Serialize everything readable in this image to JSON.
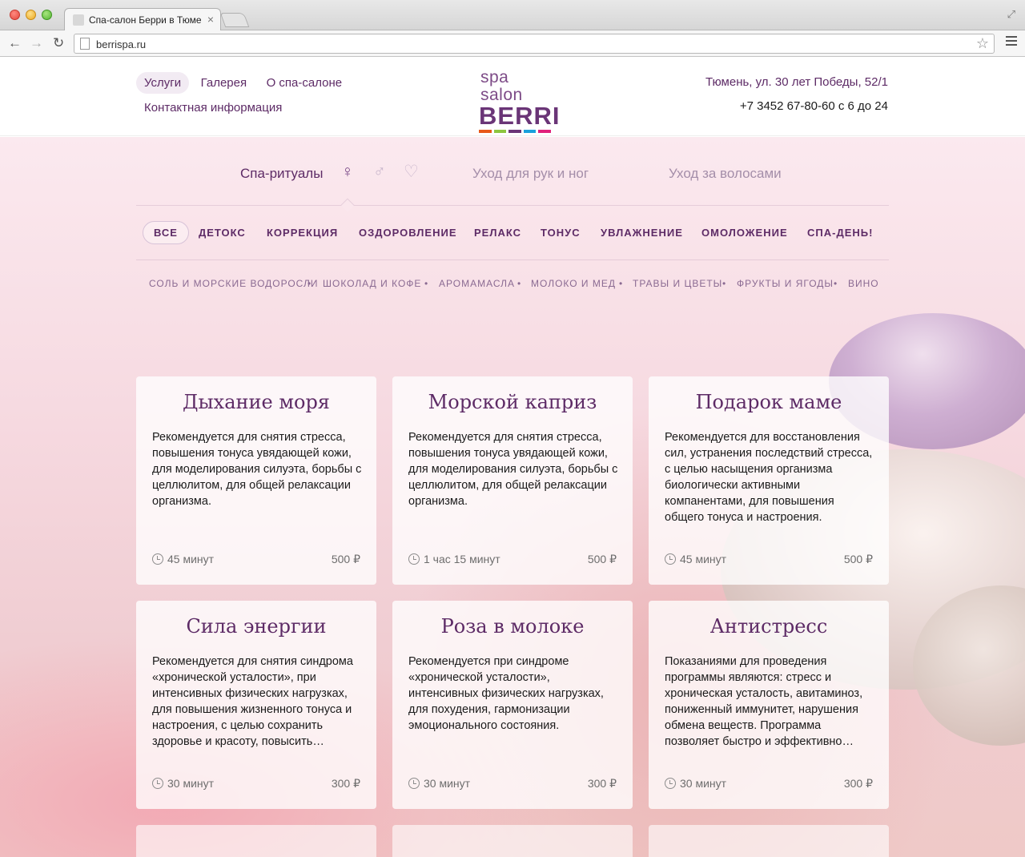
{
  "browser": {
    "tab_title": "Спа-салон Берри в Тюме",
    "url": "berrispa.ru"
  },
  "header": {
    "nav": [
      "Услуги",
      "Галерея",
      "О спа-салоне",
      "Контактная информация"
    ],
    "logo_sub": "spa salon",
    "logo_main": "BERRI",
    "logo_colors": [
      "#e8591a",
      "#8dc63f",
      "#6a3577",
      "#1aa1dc",
      "#e0217b"
    ],
    "address": "Тюмень, ул. 30 лет Победы, 52/1",
    "phone": "+7 3452 67-80-60  с 6 до 24"
  },
  "categories": {
    "spa": "Спа-ритуалы",
    "hands": "Уход для рук и ног",
    "hair": "Уход за волосами"
  },
  "filters": [
    "ВСЕ",
    "ДЕТОКС",
    "КОРРЕКЦИЯ",
    "ОЗДОРОВЛЕНИЕ",
    "РЕЛАКС",
    "ТОНУС",
    "УВЛАЖНЕНИЕ",
    "ОМОЛОЖЕНИЕ",
    "СПА-ДЕНЬ!"
  ],
  "subfilters": [
    "СОЛЬ И МОРСКИЕ ВОДОРОСЛИ",
    "ШОКОЛАД И КОФЕ",
    "АРОМАМАСЛА",
    "МОЛОКО И МЕД",
    "ТРАВЫ И ЦВЕТЫ",
    "ФРУКТЫ И ЯГОДЫ",
    "ВИНО"
  ],
  "cards": [
    {
      "title": "Дыхание моря",
      "desc": "Рекомендуется для снятия стресса, повышения тонуса увядающей кожи, для моделирования силуэта, борьбы с целлюлитом, для общей релаксации организма.",
      "time": "45 минут",
      "price": "500 ₽"
    },
    {
      "title": "Морской каприз",
      "desc": "Рекомендуется для снятия стресса, повышения тонуса увядающей кожи, для моделирования силуэта, борьбы с целлюлитом, для общей релаксации организма.",
      "time": "1 час 15 минут",
      "price": "500 ₽"
    },
    {
      "title": "Подарок маме",
      "desc": "Рекомендуется для восстановления сил, устранения последствий стресса, с целью насыщения организма биологически активными компанентами, для повышения общего тонуса и настроения.",
      "time": "45 минут",
      "price": "500 ₽"
    },
    {
      "title": "Сила энергии",
      "desc": "Рекомендуется для снятия синдрома «хронической усталости», при интенсивных физических нагрузках, для повышения жизненного тонуса и настроения, с целью сохранить здоровье и красоту, повысить…",
      "time": "30 минут",
      "price": "300 ₽"
    },
    {
      "title": "Роза в молоке",
      "desc": "Рекомендуется при синдроме «хронической усталости», интенсивных физических нагрузках, для похудения, гармонизации эмоционального состояния.",
      "time": "30 минут",
      "price": "300 ₽"
    },
    {
      "title": "Антистресс",
      "desc": "Показаниями для проведения программы являются: стресс и хроническая усталость, авитаминоз, пониженный иммунитет, нарушения обмена веществ. Программа позволяет быстро и эффективно…",
      "time": "30 минут",
      "price": "300 ₽"
    }
  ]
}
